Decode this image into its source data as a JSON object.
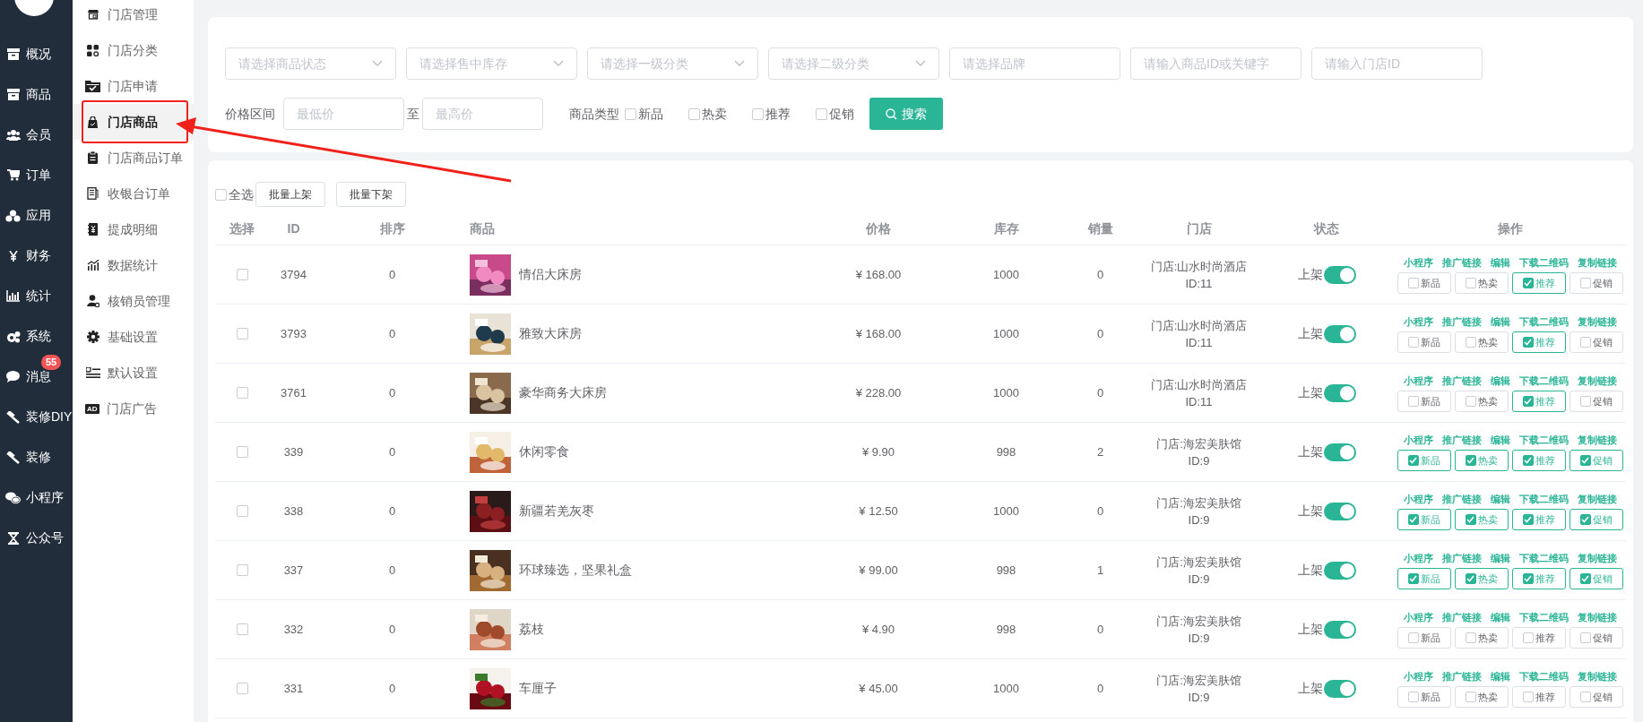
{
  "nav": {
    "items": [
      {
        "label": "概况",
        "selected": false
      },
      {
        "label": "商品",
        "selected": false
      },
      {
        "label": "会员",
        "selected": false
      },
      {
        "label": "订单",
        "selected": false
      },
      {
        "label": "应用",
        "selected": false
      },
      {
        "label": "财务",
        "selected": false
      },
      {
        "label": "统计",
        "selected": false
      },
      {
        "label": "系统",
        "selected": false
      },
      {
        "label": "消息",
        "selected": false,
        "badge": "55"
      },
      {
        "label": "装修DIY",
        "selected": false
      },
      {
        "label": "装修",
        "selected": false
      },
      {
        "label": "小程序",
        "selected": false
      },
      {
        "label": "公众号",
        "selected": false
      }
    ]
  },
  "subnav": {
    "items": [
      {
        "label": "门店管理",
        "selected": false
      },
      {
        "label": "门店分类",
        "selected": false
      },
      {
        "label": "门店申请",
        "selected": false
      },
      {
        "label": "门店商品",
        "selected": true
      },
      {
        "label": "门店商品订单",
        "selected": false
      },
      {
        "label": "收银台订单",
        "selected": false
      },
      {
        "label": "提成明细",
        "selected": false
      },
      {
        "label": "数据统计",
        "selected": false
      },
      {
        "label": "核销员管理",
        "selected": false
      },
      {
        "label": "基础设置",
        "selected": false
      },
      {
        "label": "默认设置",
        "selected": false
      },
      {
        "label": "门店广告",
        "selected": false,
        "icon_text": "AD"
      }
    ]
  },
  "filters": {
    "fields": [
      {
        "kind": "select",
        "placeholder": "请选择商品状态"
      },
      {
        "kind": "select",
        "placeholder": "请选择售中库存"
      },
      {
        "kind": "select",
        "placeholder": "请选择一级分类"
      },
      {
        "kind": "select",
        "placeholder": "请选择二级分类"
      },
      {
        "kind": "input",
        "placeholder": "请选择品牌"
      },
      {
        "kind": "input",
        "placeholder": "请输入商品ID或关键字"
      },
      {
        "kind": "input",
        "placeholder": "请输入门店ID"
      }
    ],
    "price_range": {
      "label": "价格区间",
      "min_placeholder": "最低价",
      "separator": "至",
      "max_placeholder": "最高价"
    },
    "type_filter": {
      "label": "商品类型",
      "options": [
        {
          "label": "新品",
          "checked": false
        },
        {
          "label": "热卖",
          "checked": false
        },
        {
          "label": "推荐",
          "checked": false
        },
        {
          "label": "促销",
          "checked": false
        }
      ]
    },
    "search_button": "搜索"
  },
  "bulk": {
    "select_all": {
      "label": "全选",
      "checked": false
    },
    "buttons": [
      "批量上架",
      "批量下架"
    ]
  },
  "table": {
    "columns": [
      "选择",
      "ID",
      "排序",
      "商品",
      "价格",
      "库存",
      "销量",
      "门店",
      "状态",
      "操作"
    ],
    "rows": [
      {
        "selected": false,
        "id": "3794",
        "sort": "0",
        "name": "情侣大床房",
        "price": "¥ 168.00",
        "stock": "1000",
        "sales": "0",
        "store": "门店:山水时尚酒店",
        "store_id": "ID:11",
        "status": {
          "label": "上架",
          "on": true
        },
        "links": [
          "小程序",
          "推广链接",
          "编辑",
          "下载二维码",
          "复制链接"
        ],
        "flags": [
          {
            "label": "新品",
            "checked": false
          },
          {
            "label": "热卖",
            "checked": false
          },
          {
            "label": "推荐",
            "checked": true
          },
          {
            "label": "促销",
            "checked": false
          }
        ]
      },
      {
        "selected": false,
        "id": "3793",
        "sort": "0",
        "name": "雅致大床房",
        "price": "¥ 168.00",
        "stock": "1000",
        "sales": "0",
        "store": "门店:山水时尚酒店",
        "store_id": "ID:11",
        "status": {
          "label": "上架",
          "on": true
        },
        "links": [
          "小程序",
          "推广链接",
          "编辑",
          "下载二维码",
          "复制链接"
        ],
        "flags": [
          {
            "label": "新品",
            "checked": false
          },
          {
            "label": "热卖",
            "checked": false
          },
          {
            "label": "推荐",
            "checked": true
          },
          {
            "label": "促销",
            "checked": false
          }
        ]
      },
      {
        "selected": false,
        "id": "3761",
        "sort": "0",
        "name": "豪华商务大床房",
        "price": "¥ 228.00",
        "stock": "1000",
        "sales": "0",
        "store": "门店:山水时尚酒店",
        "store_id": "ID:11",
        "status": {
          "label": "上架",
          "on": true
        },
        "links": [
          "小程序",
          "推广链接",
          "编辑",
          "下载二维码",
          "复制链接"
        ],
        "flags": [
          {
            "label": "新品",
            "checked": false
          },
          {
            "label": "热卖",
            "checked": false
          },
          {
            "label": "推荐",
            "checked": true
          },
          {
            "label": "促销",
            "checked": false
          }
        ]
      },
      {
        "selected": false,
        "id": "339",
        "sort": "0",
        "name": "休闲零食",
        "price": "¥ 9.90",
        "stock": "998",
        "sales": "2",
        "store": "门店:海宏美肤馆",
        "store_id": "ID:9",
        "status": {
          "label": "上架",
          "on": true
        },
        "links": [
          "小程序",
          "推广链接",
          "编辑",
          "下载二维码",
          "复制链接"
        ],
        "flags": [
          {
            "label": "新品",
            "checked": true
          },
          {
            "label": "热卖",
            "checked": true
          },
          {
            "label": "推荐",
            "checked": true
          },
          {
            "label": "促销",
            "checked": true
          }
        ]
      },
      {
        "selected": false,
        "id": "338",
        "sort": "0",
        "name": "新疆若羌灰枣",
        "price": "¥ 12.50",
        "stock": "1000",
        "sales": "0",
        "store": "门店:海宏美肤馆",
        "store_id": "ID:9",
        "status": {
          "label": "上架",
          "on": true
        },
        "links": [
          "小程序",
          "推广链接",
          "编辑",
          "下载二维码",
          "复制链接"
        ],
        "flags": [
          {
            "label": "新品",
            "checked": true
          },
          {
            "label": "热卖",
            "checked": true
          },
          {
            "label": "推荐",
            "checked": true
          },
          {
            "label": "促销",
            "checked": true
          }
        ]
      },
      {
        "selected": false,
        "id": "337",
        "sort": "0",
        "name": "环球臻选，坚果礼盒",
        "price": "¥ 99.00",
        "stock": "998",
        "sales": "1",
        "store": "门店:海宏美肤馆",
        "store_id": "ID:9",
        "status": {
          "label": "上架",
          "on": true
        },
        "links": [
          "小程序",
          "推广链接",
          "编辑",
          "下载二维码",
          "复制链接"
        ],
        "flags": [
          {
            "label": "新品",
            "checked": true
          },
          {
            "label": "热卖",
            "checked": true
          },
          {
            "label": "推荐",
            "checked": true
          },
          {
            "label": "促销",
            "checked": true
          }
        ]
      },
      {
        "selected": false,
        "id": "332",
        "sort": "0",
        "name": "荔枝",
        "price": "¥ 4.90",
        "stock": "998",
        "sales": "0",
        "store": "门店:海宏美肤馆",
        "store_id": "ID:9",
        "status": {
          "label": "上架",
          "on": true
        },
        "links": [
          "小程序",
          "推广链接",
          "编辑",
          "下载二维码",
          "复制链接"
        ],
        "flags": [
          {
            "label": "新品",
            "checked": false
          },
          {
            "label": "热卖",
            "checked": false
          },
          {
            "label": "推荐",
            "checked": false
          },
          {
            "label": "促销",
            "checked": false
          }
        ]
      },
      {
        "selected": false,
        "id": "331",
        "sort": "0",
        "name": "车厘子",
        "price": "¥ 45.00",
        "stock": "1000",
        "sales": "0",
        "store": "门店:海宏美肤馆",
        "store_id": "ID:9",
        "status": {
          "label": "上架",
          "on": true
        },
        "links": [
          "小程序",
          "推广链接",
          "编辑",
          "下载二维码",
          "复制链接"
        ],
        "flags": [
          {
            "label": "新品",
            "checked": false
          },
          {
            "label": "热卖",
            "checked": false
          },
          {
            "label": "推荐",
            "checked": false
          },
          {
            "label": "促销",
            "checked": false
          }
        ]
      }
    ]
  }
}
